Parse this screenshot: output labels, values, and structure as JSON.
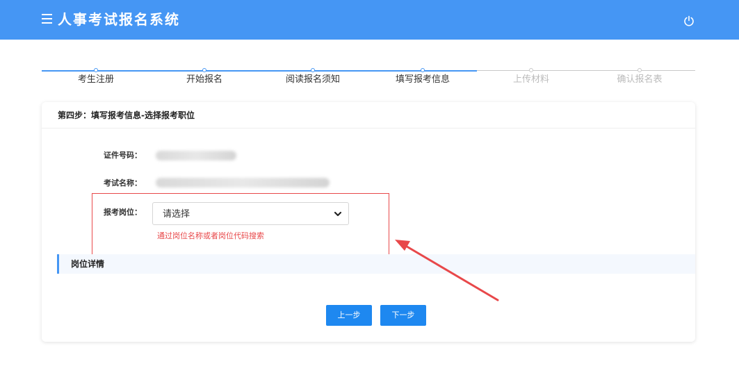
{
  "header": {
    "title": "人事考试报名系统",
    "menu_icon": "menu-icon",
    "power_icon": "power-icon"
  },
  "steps": [
    {
      "label": "考生注册",
      "state": "done"
    },
    {
      "label": "开始报名",
      "state": "done"
    },
    {
      "label": "阅读报名须知",
      "state": "done"
    },
    {
      "label": "填写报考信息",
      "state": "done"
    },
    {
      "label": "上传材料",
      "state": "todo"
    },
    {
      "label": "确认报名表",
      "state": "todo"
    }
  ],
  "card": {
    "title": "第四步：填写报考信息-选择报考职位"
  },
  "form": {
    "id_label": "证件号码：",
    "exam_label": "考试名称：",
    "position_label": "报考岗位：",
    "select_value": "请选择",
    "hint": "通过岗位名称或者岗位代码搜索"
  },
  "section": {
    "title": "岗位详情"
  },
  "buttons": {
    "prev": "上一步",
    "next": "下一步"
  },
  "colors": {
    "accent": "#4596f4",
    "button": "#1e88f0",
    "annotation": "#e8484a"
  }
}
